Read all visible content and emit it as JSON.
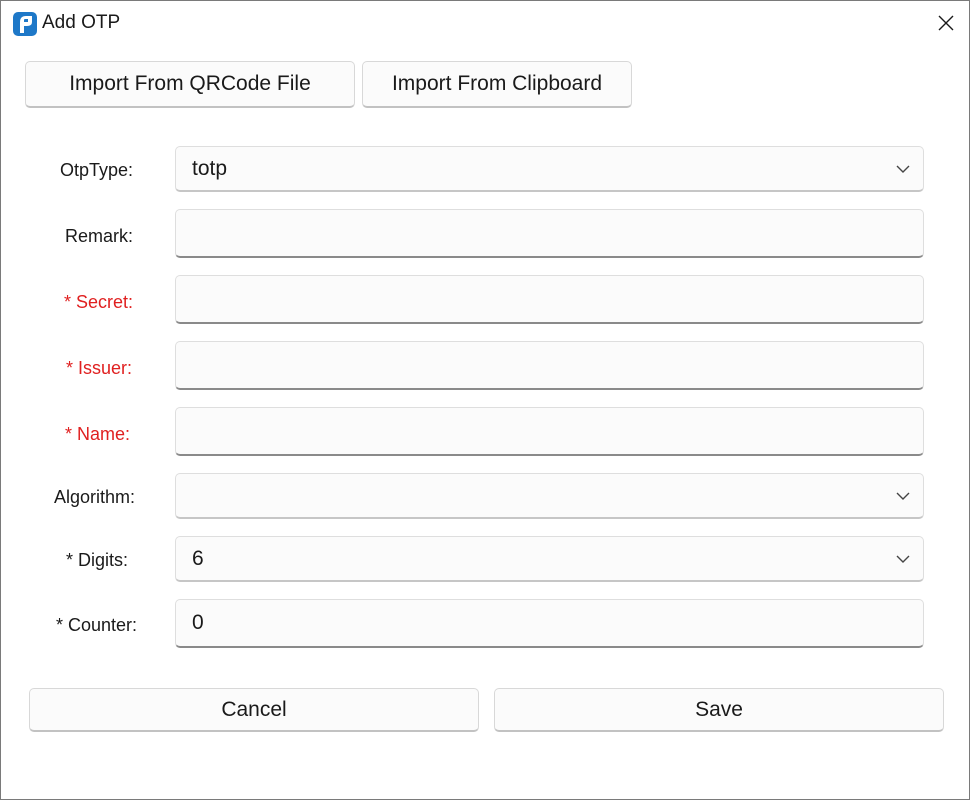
{
  "window": {
    "title": "Add OTP"
  },
  "toolbar": {
    "import_qr_label": "Import From QRCode File",
    "import_clipboard_label": "Import From Clipboard"
  },
  "form": {
    "otp_type": {
      "label": "OtpType:",
      "value": "totp"
    },
    "remark": {
      "label": "Remark:",
      "value": ""
    },
    "secret": {
      "label": "* Secret:",
      "value": ""
    },
    "issuer": {
      "label": "* Issuer:",
      "value": ""
    },
    "name": {
      "label": "* Name:",
      "value": ""
    },
    "algorithm": {
      "label": "Algorithm:",
      "value": ""
    },
    "digits": {
      "label": "* Digits:",
      "value": "6"
    },
    "counter": {
      "label": "* Counter:",
      "value": "0"
    }
  },
  "footer": {
    "cancel_label": "Cancel",
    "save_label": "Save"
  },
  "colors": {
    "required": "#e02020",
    "app_icon": "#1e78c8"
  },
  "icons": {
    "app": "app-logo-icon",
    "close": "close-icon",
    "dropdown": "chevron-down-icon"
  }
}
